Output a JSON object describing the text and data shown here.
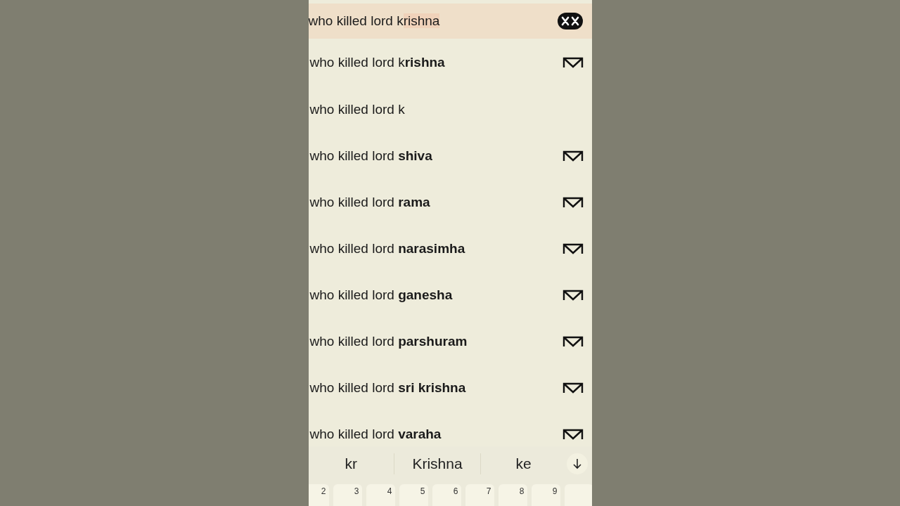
{
  "search": {
    "value": "who killed lord k",
    "composing": "rishna"
  },
  "suggestions": [
    {
      "text": "who killed lord k**rishna**",
      "fill_icon": true
    },
    {
      "text": "who killed lord k",
      "fill_icon": false
    },
    {
      "text": "who killed lord **shiva**",
      "fill_icon": true
    },
    {
      "text": "who killed lord **rama**",
      "fill_icon": true
    },
    {
      "text": "who killed lord **narasimha**",
      "fill_icon": true
    },
    {
      "text": "who killed lord **ganesha**",
      "fill_icon": true
    },
    {
      "text": "who killed lord **parshuram**",
      "fill_icon": true
    },
    {
      "text": "who killed lord **sri krishna**",
      "fill_icon": true
    },
    {
      "text": "who killed lord **varaha**",
      "fill_icon": true
    }
  ],
  "word_suggestions": [
    "kr",
    "Krishna",
    "ke"
  ],
  "key_hints": [
    "2",
    "3",
    "4",
    "5",
    "6",
    "7",
    "8",
    "9"
  ]
}
